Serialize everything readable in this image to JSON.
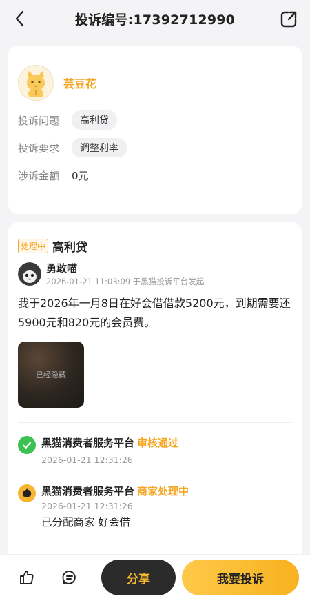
{
  "header": {
    "title": "投诉编号:17392712990"
  },
  "complainant": {
    "name": "芸豆花"
  },
  "info": {
    "issue_label": "投诉问题",
    "issue_value": "高利贷",
    "request_label": "投诉要求",
    "request_value": "调整利率",
    "amount_label": "涉诉金额",
    "amount_value": "0元"
  },
  "complaint": {
    "status_badge": "处理中",
    "title": "高利贷",
    "poster_name": "勇敢喵",
    "poster_meta": "2026-01-21 11:03:09 于黑猫投诉平台发起",
    "content": "我于2026年一月8日在好会借借款5200元，到期需要还5900元和820元的会员费。",
    "image_hidden_text": "已经隐藏"
  },
  "timeline": [
    {
      "actor": "黑猫消费者服务平台",
      "status": "审核通过",
      "time": "2026-01-21 12:31:26",
      "note": ""
    },
    {
      "actor": "黑猫消费者服务平台",
      "status": "商家处理中",
      "time": "2026-01-21 12:31:26",
      "note": "已分配商家 好会借"
    }
  ],
  "bottom": {
    "share_label": "分享",
    "complain_label": "我要投诉"
  },
  "colors": {
    "accent": "#f5a623",
    "status_green": "#3cc251",
    "dark_button": "#2b2b2b"
  },
  "icons": {
    "back": "back-arrow-icon",
    "external": "external-share-icon",
    "like": "thumbs-up-icon",
    "comment": "comment-icon",
    "check": "check-circle-icon",
    "cat": "black-cat-icon"
  }
}
